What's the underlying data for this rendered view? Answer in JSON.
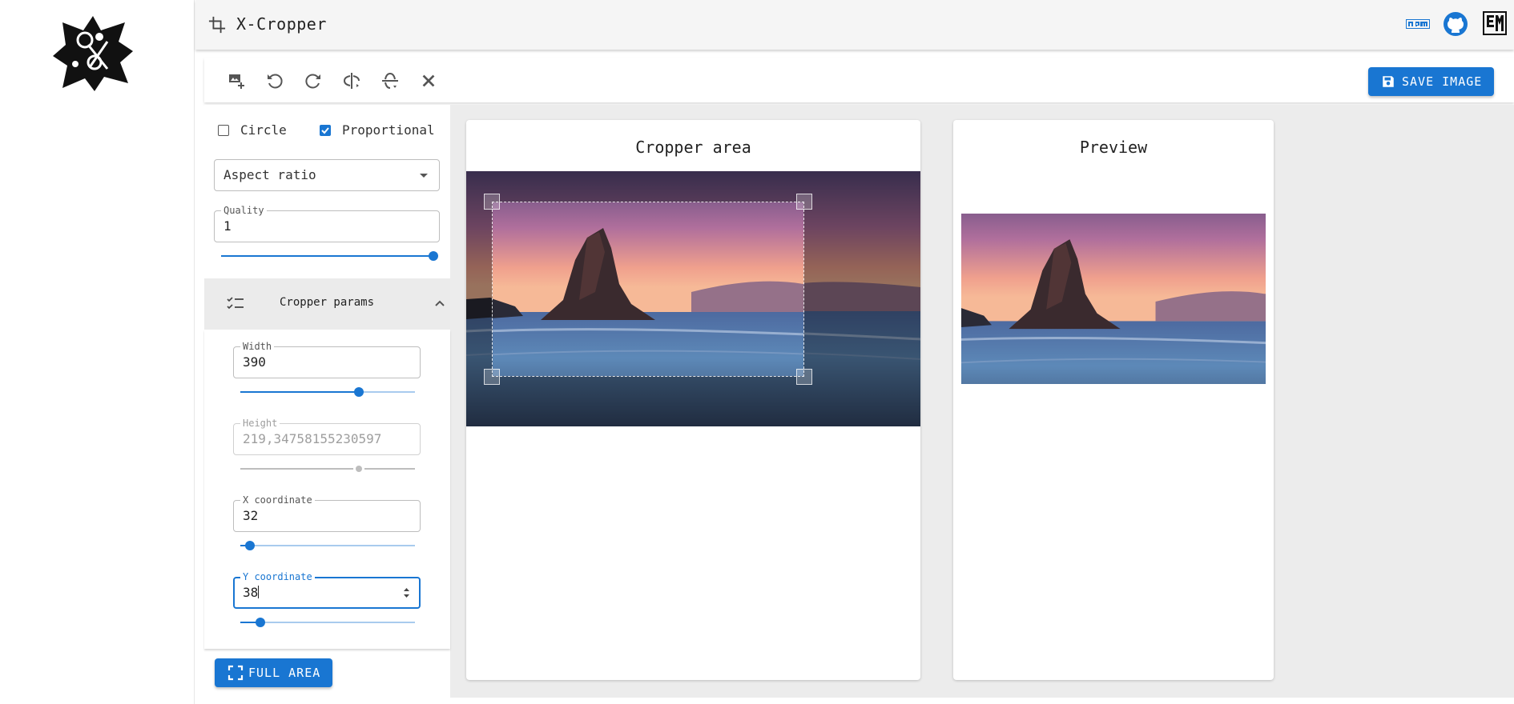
{
  "app": {
    "title": "X-Cropper",
    "links": [
      "npm",
      "github",
      "em"
    ]
  },
  "toolbar": {
    "buttons": [
      "add-image",
      "rotate-left",
      "rotate-right",
      "flip-horizontal",
      "flip-vertical",
      "close"
    ],
    "save_label": "SAVE IMAGE"
  },
  "options": {
    "circle_label": "Circle",
    "circle_checked": false,
    "proportional_label": "Proportional",
    "proportional_checked": true,
    "aspect_ratio_placeholder": "Aspect ratio",
    "quality_label": "Quality",
    "quality_value": "1",
    "quality_slider": 1.0
  },
  "params": {
    "header_label": "Cropper params",
    "expanded": true,
    "width_label": "Width",
    "width_value": "390",
    "width_slider": 0.68,
    "height_label": "Height",
    "height_value": "219,34758155230597",
    "height_slider": 0.68,
    "height_disabled": true,
    "x_label": "X coordinate",
    "x_value": "32",
    "x_slider": 0.055,
    "y_label": "Y coordinate",
    "y_value": "38",
    "y_slider": 0.115
  },
  "full_area_label": "FULL AREA",
  "cropper": {
    "title": "Cropper area"
  },
  "preview": {
    "title": "Preview"
  },
  "colors": {
    "accent": "#1976d2",
    "header_bg": "#f5f5f5",
    "workspace_bg": "#ececec"
  }
}
